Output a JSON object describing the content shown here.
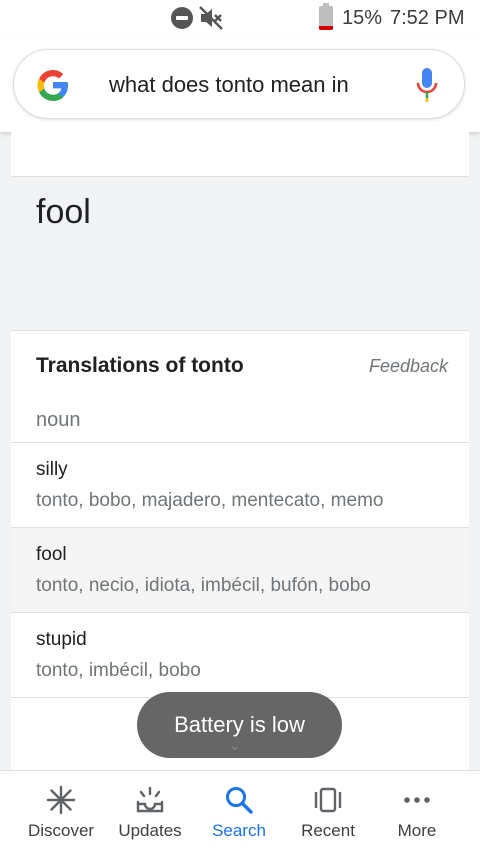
{
  "status_bar": {
    "battery_percent": "15%",
    "time": "7:52 PM"
  },
  "search": {
    "query": "what does tonto mean in"
  },
  "result": {
    "translation": "fool"
  },
  "translations": {
    "title": "Translations of tonto",
    "feedback_label": "Feedback",
    "part_of_speech": "noun",
    "rows": [
      {
        "word": "silly",
        "synonyms": "tonto, bobo, majadero, mentecato, memo"
      },
      {
        "word": "fool",
        "synonyms": "tonto, necio, idiota, imbécil, bufón, bobo"
      },
      {
        "word": "stupid",
        "synonyms": "tonto, imbécil, bobo"
      }
    ]
  },
  "toast": {
    "message": "Battery is low"
  },
  "bottom_nav": [
    {
      "label": "Discover",
      "icon": "asterisk-icon"
    },
    {
      "label": "Updates",
      "icon": "inbox-updates-icon"
    },
    {
      "label": "Search",
      "icon": "search-icon",
      "active": true
    },
    {
      "label": "Recent",
      "icon": "recent-tabs-icon"
    },
    {
      "label": "More",
      "icon": "more-dots-icon"
    }
  ],
  "colors": {
    "accent": "#1a73e8",
    "battery_low": "#d50000",
    "toast_bg": "#666666"
  }
}
